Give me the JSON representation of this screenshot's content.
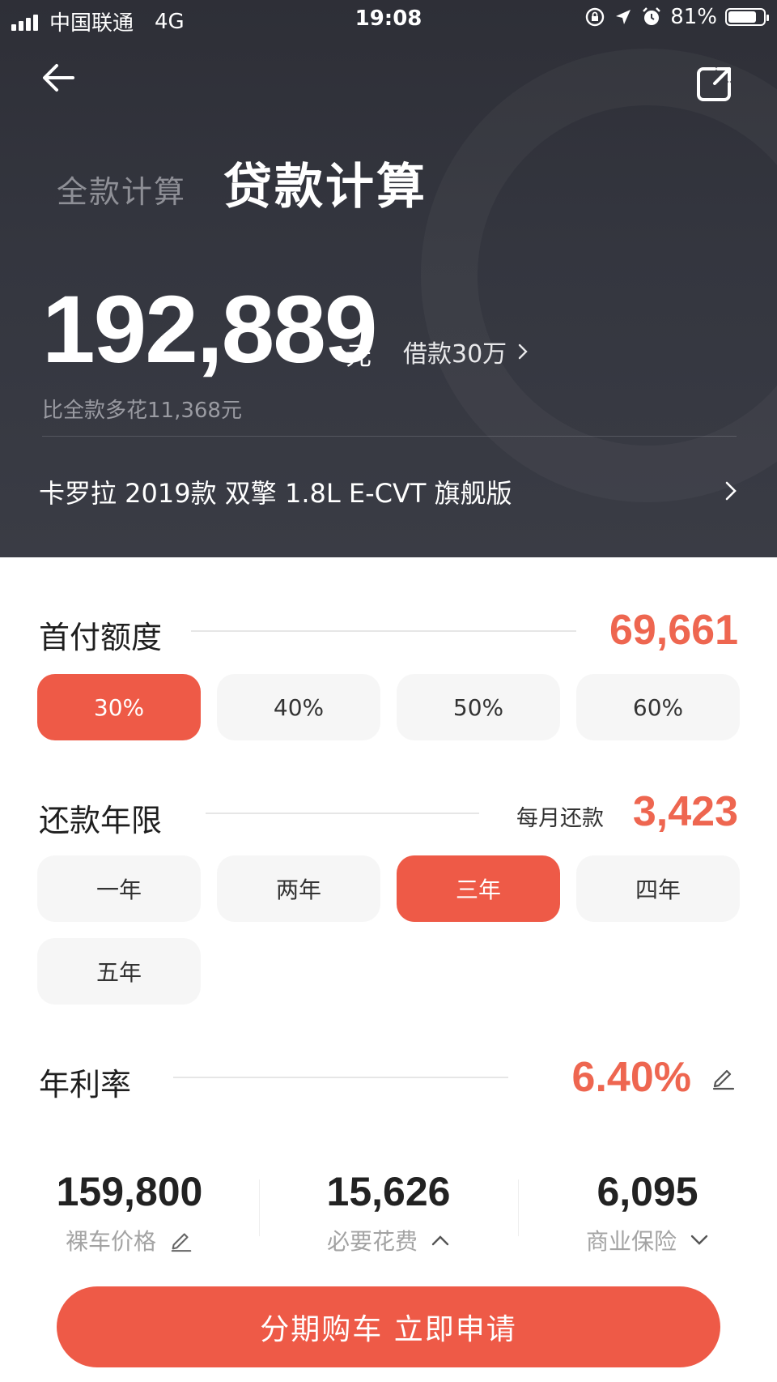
{
  "status_bar": {
    "carrier": "中国联通",
    "network": "4G",
    "time": "19:08",
    "battery": "81%",
    "battery_level": 0.81
  },
  "header": {
    "tab_full": "全款计算",
    "tab_loan": "贷款计算",
    "total_amount": "192,889",
    "total_unit": "元",
    "loan_link": "借款30万",
    "extra_cost": "比全款多花11,368元",
    "car_model": "卡罗拉 2019款 双擎 1.8L E-CVT 旗舰版",
    "icons": {
      "back": "arrow-left-icon",
      "share": "share-icon",
      "chevron": "chevron-right-icon"
    }
  },
  "down_payment": {
    "title": "首付额度",
    "value": "69,661",
    "options": [
      "30%",
      "40%",
      "50%",
      "60%"
    ],
    "selected": 0
  },
  "term": {
    "title": "还款年限",
    "monthly_label": "每月还款",
    "monthly_value": "3,423",
    "options": [
      "一年",
      "两年",
      "三年",
      "四年",
      "五年"
    ],
    "selected": 2
  },
  "rate": {
    "title": "年利率",
    "value": "6.40%"
  },
  "summary": {
    "car_price": {
      "value": "159,800",
      "label": "裸车价格"
    },
    "fees": {
      "value": "15,626",
      "label": "必要花费"
    },
    "insurance": {
      "value": "6,095",
      "label": "商业保险"
    }
  },
  "apply_button": "分期购车 立即申请",
  "colors": {
    "accent": "#ee5a47",
    "accent_text": "#ee6650",
    "header_bg": "#33353e"
  }
}
